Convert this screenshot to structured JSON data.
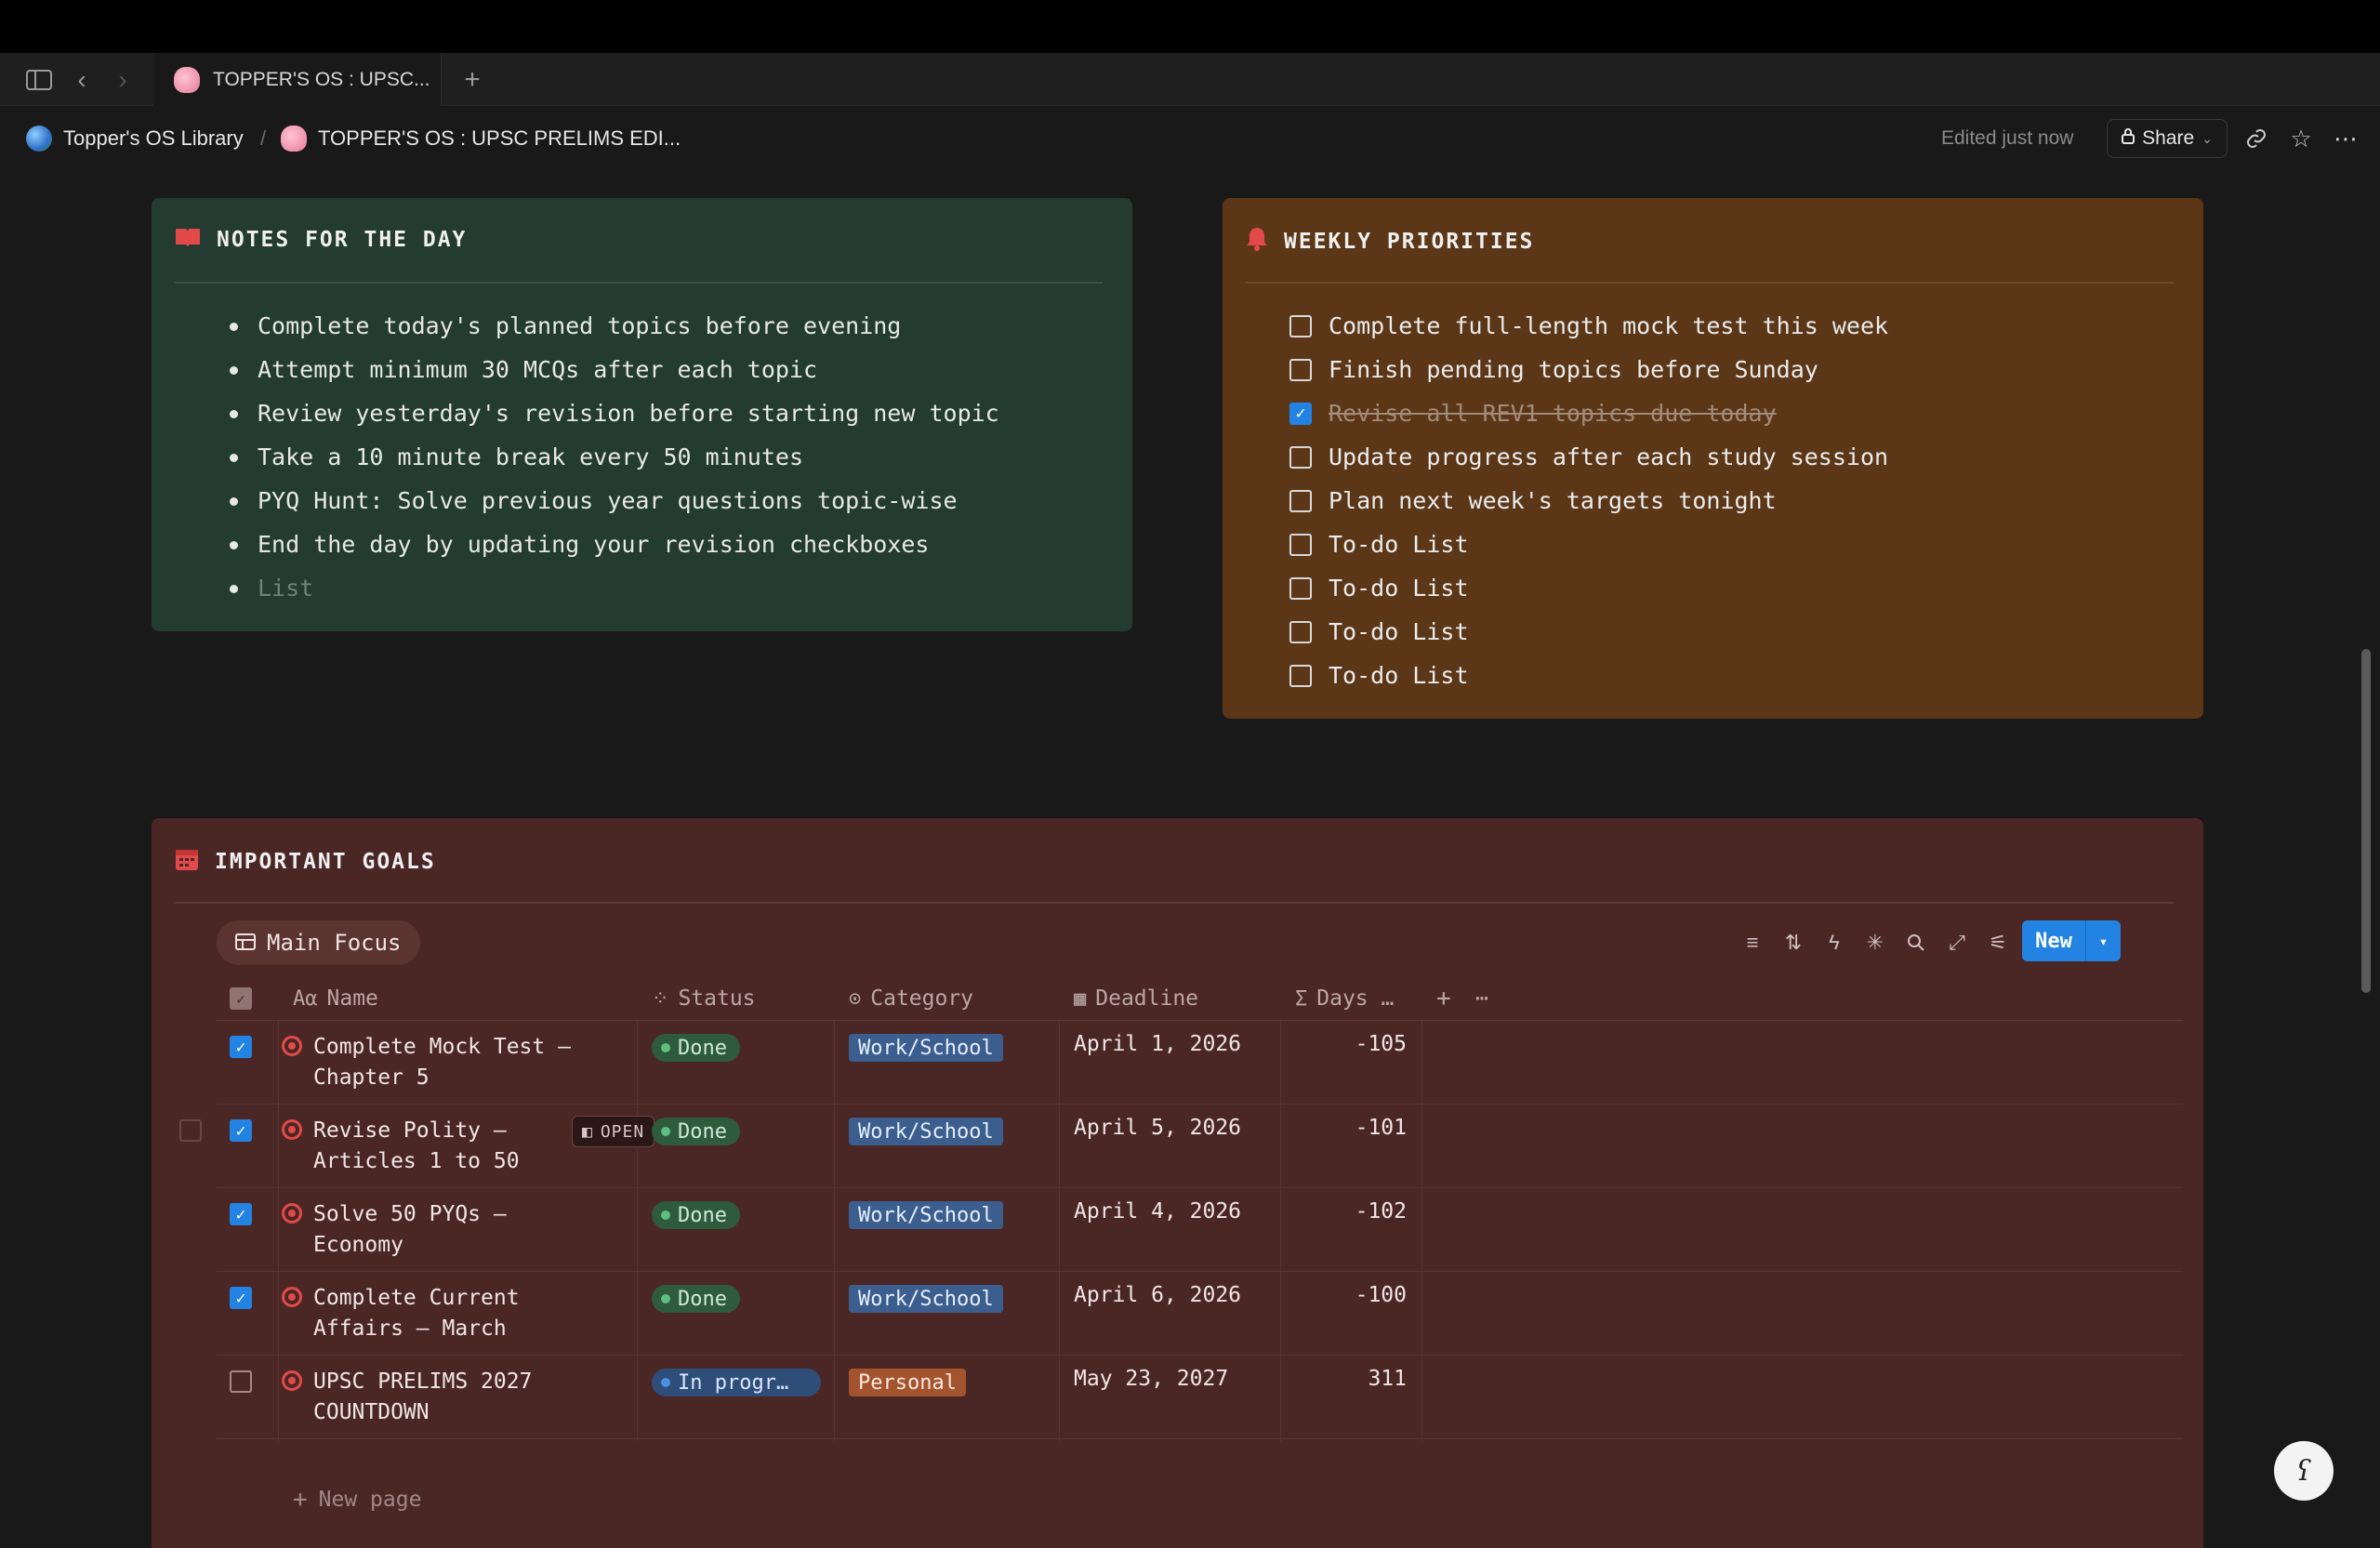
{
  "tabbar": {
    "active_tab": "TOPPER'S OS : UPSC..."
  },
  "breadcrumb": {
    "root": "Topper's OS Library",
    "separator": "/",
    "current": "TOPPER'S OS : UPSC PRELIMS EDI..."
  },
  "header": {
    "edited": "Edited just now",
    "share_label": "Share"
  },
  "notes": {
    "title": "NOTES FOR THE DAY",
    "items": [
      "Complete today's planned topics before evening",
      "Attempt minimum 30 MCQs after each topic",
      "Review yesterday's revision before starting new topic",
      "Take a 10 minute break every 50 minutes",
      "PYQ Hunt: Solve previous year questions topic-wise",
      "End the day by updating your revision checkboxes"
    ],
    "placeholder": "List"
  },
  "weekly": {
    "title": "WEEKLY PRIORITIES",
    "items": [
      {
        "text": "Complete full-length mock test this week",
        "checked": false
      },
      {
        "text": "Finish pending topics before Sunday",
        "checked": false
      },
      {
        "text": "Revise all REV1 topics due today",
        "checked": true
      },
      {
        "text": "Update progress after each study session",
        "checked": false
      },
      {
        "text": "Plan next week's targets tonight",
        "checked": false
      },
      {
        "text": "To-do List",
        "checked": false
      },
      {
        "text": "To-do List",
        "checked": false
      },
      {
        "text": "To-do List",
        "checked": false
      },
      {
        "text": "To-do List",
        "checked": false
      }
    ]
  },
  "goals": {
    "title": "IMPORTANT GOALS",
    "view_tab": "Main Focus",
    "new_label": "New",
    "open_label": "OPEN",
    "new_page_label": "New page",
    "columns": {
      "name": "Name",
      "status": "Status",
      "category": "Category",
      "deadline": "Deadline",
      "days": "Days …"
    },
    "rows": [
      {
        "checked": true,
        "name_line1": "Complete Mock Test —",
        "name_line2": "Chapter 5",
        "status": "Done",
        "category": "Work/School",
        "deadline": "April 1, 2026",
        "days": "-105"
      },
      {
        "checked": true,
        "name_line1": "Revise Polity —",
        "name_line2": "Articles 1 to 50",
        "status": "Done",
        "category": "Work/School",
        "deadline": "April 5, 2026",
        "days": "-101"
      },
      {
        "checked": true,
        "name_line1": "Solve 50 PYQs —",
        "name_line2": "Economy",
        "status": "Done",
        "category": "Work/School",
        "deadline": "April 4, 2026",
        "days": "-102"
      },
      {
        "checked": true,
        "name_line1": "Complete Current",
        "name_line2": "Affairs — March",
        "status": "Done",
        "category": "Work/School",
        "deadline": "April 6, 2026",
        "days": "-100"
      },
      {
        "checked": false,
        "name_line1": "UPSC PRELIMS 2027",
        "name_line2": "COUNTDOWN",
        "status": "In progr…",
        "category": "Personal",
        "deadline": "May 23, 2027",
        "days": "311"
      }
    ]
  },
  "colors": {
    "notes_bg": "#233b30",
    "weekly_bg": "#5b3718",
    "goals_bg": "#4a2725",
    "accent": "#2383e2"
  }
}
